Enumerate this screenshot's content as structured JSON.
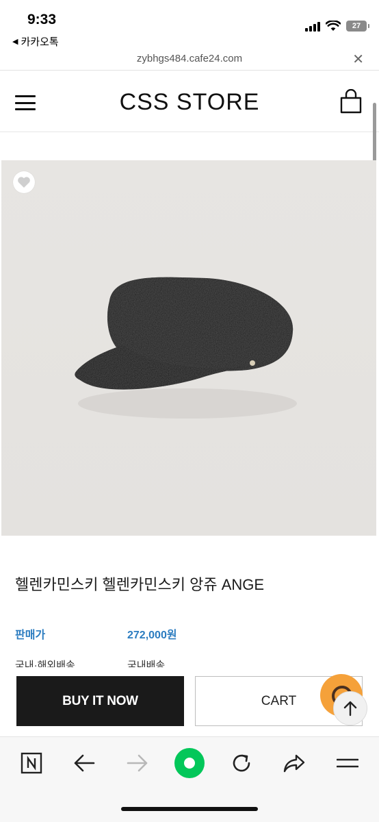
{
  "status_bar": {
    "time": "9:33",
    "back_app": "카카오톡",
    "battery": "27"
  },
  "browser": {
    "url": "zybhgs484.cafe24.com"
  },
  "store": {
    "title": "CSS STORE"
  },
  "product": {
    "name": "헬렌카민스키 헬렌카민스키 앙쥬 ANGE",
    "price_label": "판매가",
    "price_value": "272,000원",
    "shipping_label": "국내·해외배송",
    "shipping_value": "국내배송"
  },
  "actions": {
    "buy_now": "BUY IT NOW",
    "cart": "CART"
  },
  "colors": {
    "price_blue": "#2b7cc0",
    "buy_button": "#1a1a1a",
    "chat_fab": "#f5a13a",
    "naver_green": "#03c75a"
  },
  "icons": {
    "menu": "hamburger-icon",
    "bag": "shopping-bag-icon",
    "wish": "heart-icon",
    "top": "arrow-up-icon",
    "toolbar": [
      "naver-n-icon",
      "back-arrow-icon",
      "forward-arrow-icon",
      "green-dot-icon",
      "refresh-icon",
      "share-icon",
      "menu-lines-icon"
    ]
  }
}
